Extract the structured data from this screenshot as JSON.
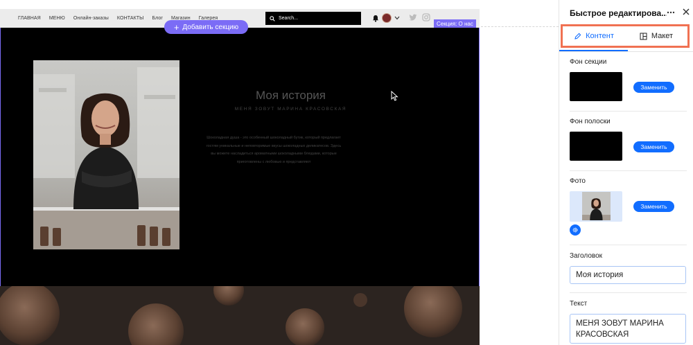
{
  "site": {
    "nav": [
      "ГЛАВНАЯ",
      "МЕНЮ",
      "Онлайн-заказы",
      "КОНТАКТЫ",
      "Блог",
      "Магазин",
      "Галерея"
    ],
    "search_placeholder": "Search...",
    "section_label": "Секция: О нас",
    "add_section_label": "Добавить секцию"
  },
  "about": {
    "title": "Моя история",
    "subtitle": "МЕНЯ ЗОВУТ МАРИНА КРАСОВСКАЯ",
    "body": "Шоколадная душа - это особенный шоколадный бутик, который предлагает гостям уникальные и неповторимые вкусы шоколадных деликатесов. Здесь вы можете насладиться ароматными шоколадными блюдами, которые приготовлены с любовью и представляют"
  },
  "panel": {
    "title": "Быстрое редактирова...",
    "tabs": {
      "content": "Контент",
      "layout": "Макет"
    },
    "section_bg_label": "Фон секции",
    "strip_bg_label": "Фон полоски",
    "photo_label": "Фото",
    "replace_label": "Заменить",
    "heading_label": "Заголовок",
    "heading_value": "Моя история",
    "text_label": "Текст",
    "text_value": "МЕНЯ ЗОВУТ МАРИНА КРАСОВСКАЯ"
  },
  "colors": {
    "accent": "#116dff",
    "section_outline": "#7b6cf6",
    "highlight_box": "#f07152"
  },
  "icons": [
    "search-icon",
    "bell-icon",
    "chevron-down-icon",
    "twitter-icon",
    "instagram-icon",
    "cursor-icon",
    "more-icon",
    "close-icon",
    "pencil-icon",
    "layout-icon",
    "gear-icon",
    "plus-icon"
  ]
}
